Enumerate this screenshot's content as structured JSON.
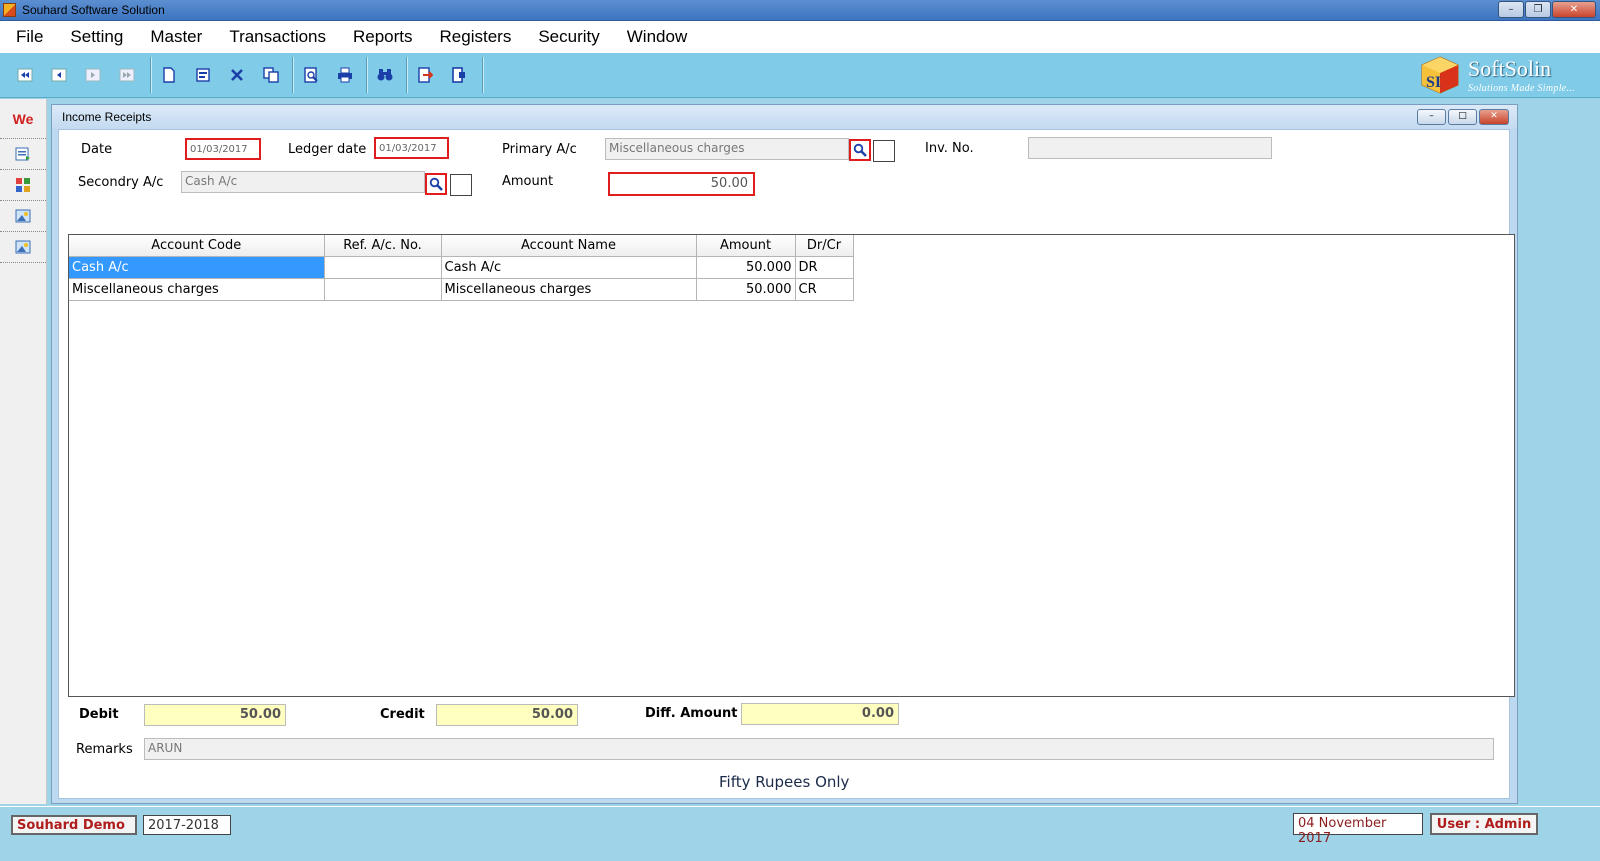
{
  "window": {
    "title": "Souhard Software Solution"
  },
  "menu": [
    "File",
    "Setting",
    "Master",
    "Transactions",
    "Reports",
    "Registers",
    "Security",
    "Window"
  ],
  "brand": {
    "name": "SoftSolin",
    "tagline": "Solutions Made Simple...",
    "letters": "SI"
  },
  "sidebar": {
    "top_label": "We"
  },
  "form": {
    "title": "Income Receipts",
    "date_label": "Date",
    "date_value": "01/03/2017",
    "ledger_date_label": "Ledger date",
    "ledger_date_value": "01/03/2017",
    "primary_label": "Primary A/c",
    "primary_value": "Miscellaneous charges",
    "inv_label": "Inv. No.",
    "inv_value": "",
    "secondary_label": "Secondry A/c",
    "secondary_value": "Cash A/c",
    "amount_label": "Amount",
    "amount_value": "50.00"
  },
  "grid": {
    "columns": [
      "Account Code",
      "Ref. A/c. No.",
      "Account Name",
      "Amount",
      "Dr/Cr"
    ],
    "rows": [
      [
        "Cash A/c",
        "",
        "Cash A/c",
        "50.000",
        "DR"
      ],
      [
        "Miscellaneous charges",
        "",
        "Miscellaneous charges",
        "50.000",
        "CR"
      ]
    ]
  },
  "totals": {
    "debit_label": "Debit",
    "debit_value": "50.00",
    "credit_label": "Credit",
    "credit_value": "50.00",
    "diff_label": "Diff. Amount",
    "diff_value": "0.00"
  },
  "remarks": {
    "label": "Remarks",
    "value": "ARUN"
  },
  "amount_in_words": "Fifty Rupees Only",
  "status": {
    "company": "Souhard Demo",
    "year": "2017-2018",
    "date": "04 November 2017",
    "user": "User : Admin"
  },
  "colors": {
    "accent_red": "#e01d1d",
    "toolbar": "#7fcbe8",
    "selection": "#3399ff",
    "total_bg": "#ffffc0"
  }
}
